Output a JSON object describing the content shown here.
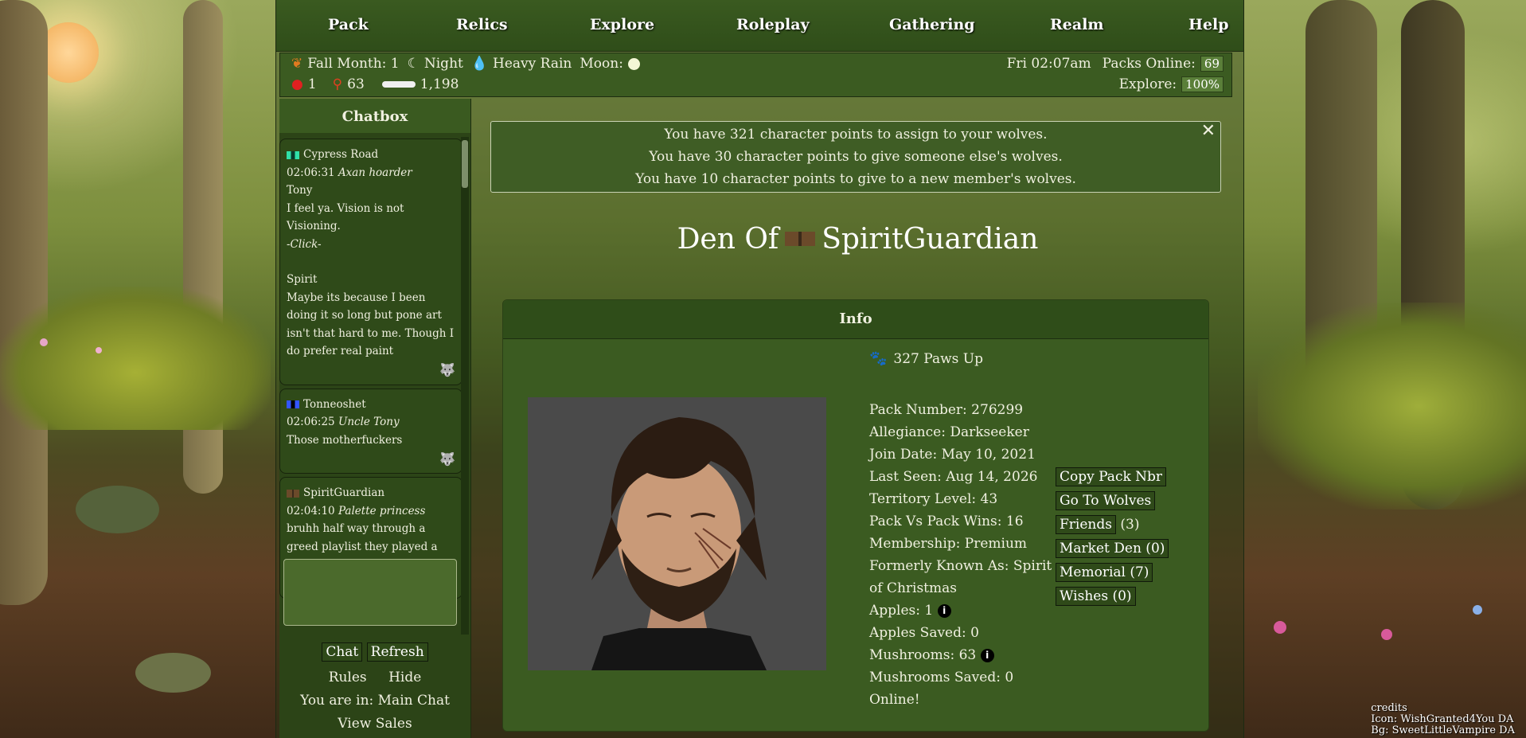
{
  "nav": {
    "items": [
      "Pack",
      "Relics",
      "Explore",
      "Roleplay",
      "Gathering",
      "Realm",
      "Help"
    ]
  },
  "status": {
    "season": "Fall Month: 1",
    "time_of_day": "Night",
    "weather": "Heavy Rain",
    "moon_label": "Moon:",
    "apples": "1",
    "mushrooms": "63",
    "bones": "1,198",
    "clock": "Fri 02:07am",
    "packs_online_label": "Packs Online:",
    "packs_online": "69",
    "explore_label": "Explore:",
    "explore_value": "100%"
  },
  "chatbox": {
    "title": "Chatbox",
    "messages": [
      {
        "user": "Cypress Road",
        "flag": [
          "#1aa07a",
          "#083b2b",
          "#30e0a8"
        ],
        "time": "02:06:31",
        "title": "Axan hoarder",
        "lines": [
          "Tony",
          "I feel ya. Vision is not Visioning.",
          "-Click-",
          "",
          "Spirit",
          "Maybe its because I been doing it so long but pone art isn't that hard to me. Though I do prefer real paint"
        ]
      },
      {
        "user": "Tonneoshet",
        "flag": [
          "#2244ff",
          "#000000",
          "#3355ff"
        ],
        "time": "02:06:25",
        "title": "Uncle Tony",
        "lines": [
          "Those motherfuckers"
        ]
      },
      {
        "user": "SpiritGuardian",
        "flag": [
          "#6b4a2a",
          "#3a2a1a",
          "#6b4a2a"
        ],
        "time": "02:04:10",
        "title": "Palette princess",
        "lines": [
          "bruhh half way through a greed playlist they played a clip of the"
        ]
      }
    ],
    "chat_button": "Chat",
    "refresh_button": "Refresh",
    "rules_link": "Rules",
    "hide_link": "Hide",
    "location": "You are in: Main Chat",
    "view_sales": "View Sales"
  },
  "notice": {
    "lines": [
      "You have 321 character points to assign to your wolves.",
      "You have 30 character points to give someone else's wolves.",
      "You have 10 character points to give to a new member's wolves."
    ],
    "close": "✕"
  },
  "den": {
    "prefix": "Den Of",
    "name": "SpiritGuardian"
  },
  "info": {
    "header": "Info",
    "paws_up": "327 Paws Up",
    "fields": [
      "Pack Number:  276299",
      "Allegiance: Darkseeker",
      "Join Date: May 10, 2021",
      "Last Seen: Aug 14, 2026",
      "Territory Level: 43",
      "Pack Vs Pack Wins: 16",
      "Membership: Premium",
      "Formerly Known As: Spirit of Christmas"
    ],
    "apples": "Apples: 1",
    "apples_saved": "Apples Saved: 0",
    "mushrooms": "Mushrooms: 63",
    "mushrooms_saved": "Mushrooms Saved: 0",
    "online": "Online!",
    "actions": {
      "copy": "Copy Pack Nbr",
      "wolves": "Go To Wolves",
      "friends": "Friends",
      "friends_count": "(3)",
      "market": "Market Den (0)",
      "memorial": "Memorial (7)",
      "wishes": "Wishes (0)"
    }
  },
  "credits": {
    "title": "credits",
    "icon": "Icon: WishGranted4You DA",
    "bg": "Bg: SweetLittleVampire DA"
  }
}
